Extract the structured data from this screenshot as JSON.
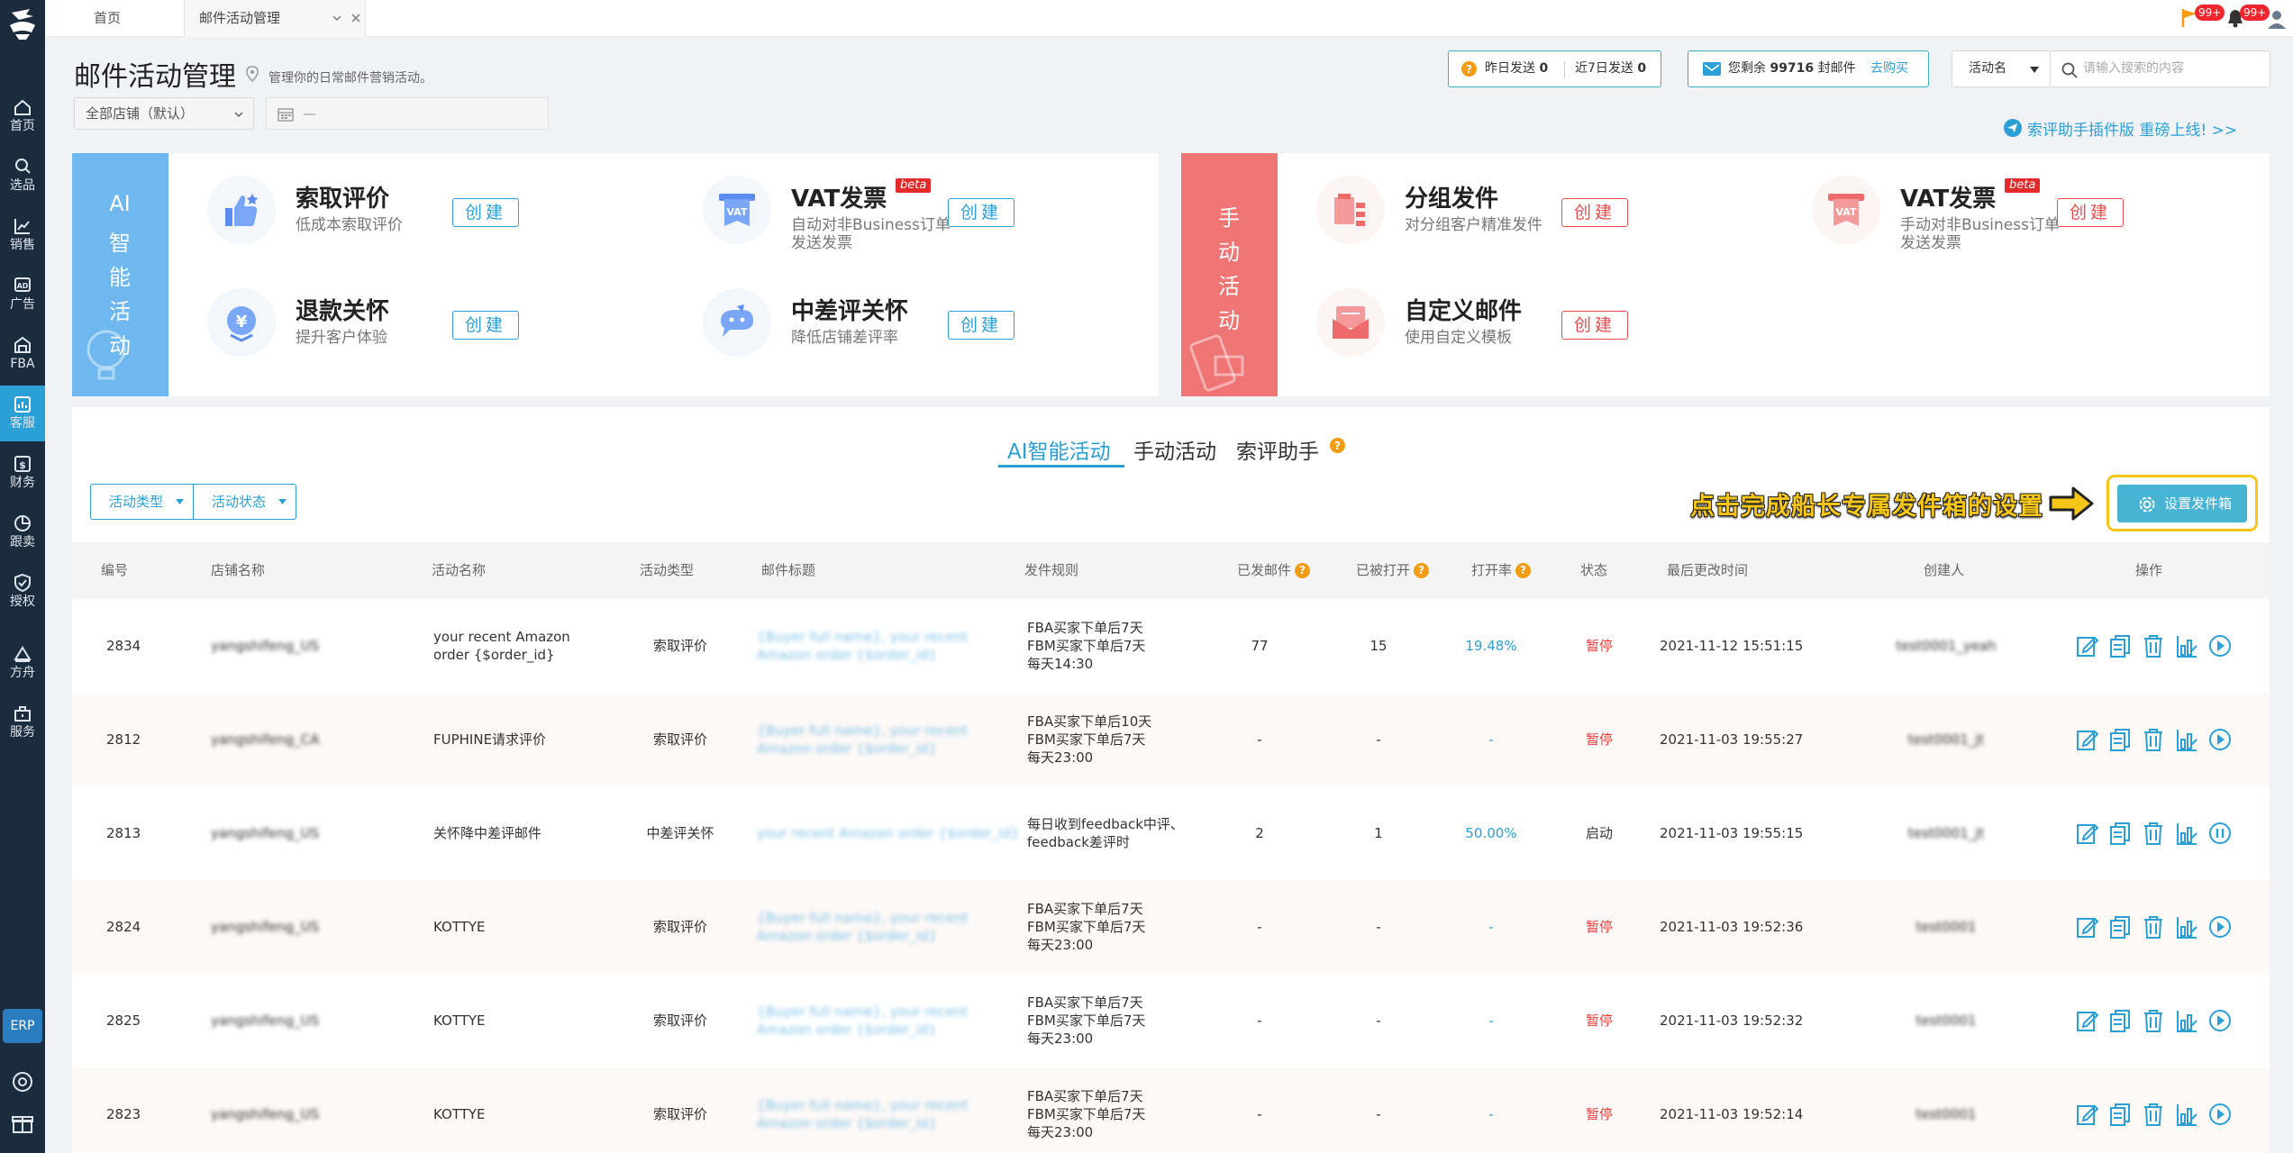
{
  "nav": [
    {
      "label": "首页",
      "icon": "home-icon"
    },
    {
      "label": "选品",
      "icon": "search-icon"
    },
    {
      "label": "销售",
      "icon": "chart-icon"
    },
    {
      "label": "广告",
      "icon": "ad-icon"
    },
    {
      "label": "FBA",
      "icon": "warehouse-icon"
    },
    {
      "label": "客服",
      "icon": "customer-service-icon"
    },
    {
      "label": "财务",
      "icon": "finance-icon"
    },
    {
      "label": "跟卖",
      "icon": "pie-icon"
    },
    {
      "label": "授权",
      "icon": "shield-icon"
    },
    {
      "label": "方舟",
      "icon": "ark-icon"
    },
    {
      "label": "服务",
      "icon": "service-icon"
    }
  ],
  "erp": "ERP",
  "tabs": {
    "home": "首页",
    "current": "邮件活动管理"
  },
  "badges": {
    "flag": "99+",
    "bell": "99+"
  },
  "page": {
    "title": "邮件活动管理",
    "subtitle": "管理你的日常邮件营销活动。"
  },
  "filters": {
    "store": "全部店铺（默认）",
    "date": "—"
  },
  "stats": {
    "yesterday_label": "昨日发送",
    "yesterday_value": "0",
    "week_label": "近7日发送",
    "week_value": "0"
  },
  "mail": {
    "remain_label": "您剩余",
    "remain_value": "99716",
    "unit": "封邮件",
    "buy": "去购买"
  },
  "search": {
    "select": "活动名",
    "placeholder": "请输入搜索的内容"
  },
  "promo": "索评助手插件版 重磅上线! >>",
  "ai_panel": {
    "ribbon": [
      "AI",
      "智",
      "能",
      "活",
      "动"
    ],
    "cards": [
      {
        "title": "索取评价",
        "desc": "低成本索取评价",
        "btn": "创建",
        "icon": "thumbs-up-icon"
      },
      {
        "title": "VAT发票",
        "desc": "自动对非Business订单发送发票",
        "btn": "创建",
        "badge": "beta",
        "icon": "vat-invoice-icon"
      },
      {
        "title": "退款关怀",
        "desc": "提升客户体验",
        "btn": "创建",
        "icon": "yuan-refund-icon"
      },
      {
        "title": "中差评关怀",
        "desc": "降低店铺差评率",
        "btn": "创建",
        "icon": "chat-care-icon"
      }
    ]
  },
  "manual_panel": {
    "ribbon": [
      "手",
      "动",
      "活",
      "动"
    ],
    "cards": [
      {
        "title": "分组发件",
        "desc": "对分组客户精准发件",
        "btn": "创建",
        "icon": "group-send-icon"
      },
      {
        "title": "VAT发票",
        "desc": "手动对非Business订单发送发票",
        "btn": "创建",
        "badge": "beta",
        "icon": "vat-invoice-icon"
      },
      {
        "title": "自定义邮件",
        "desc": "使用自定义模板",
        "btn": "创建",
        "icon": "custom-mail-icon"
      }
    ]
  },
  "main_tabs": [
    "AI智能活动",
    "手动活动",
    "索评助手"
  ],
  "filter_btns": [
    "活动类型",
    "活动状态"
  ],
  "callout": "点击完成船长专属发件箱的设置",
  "setup_btn": "设置发件箱",
  "columns": [
    "编号",
    "店铺名称",
    "活动名称",
    "活动类型",
    "邮件标题",
    "发件规则",
    "已发邮件",
    "已被打开",
    "打开率",
    "状态",
    "最后更改时间",
    "创建人",
    "操作"
  ],
  "rows": [
    {
      "id": "2834",
      "store": "yangshifeng_US",
      "name": [
        "your recent Amazon",
        "order {$order_id}"
      ],
      "type": "索取评价",
      "subject": [
        "{Buyer full name}, your recent",
        "Amazon order {$order_id}"
      ],
      "rules": [
        "FBA买家下单后7天",
        "FBM买家下单后7天",
        "每天14:30"
      ],
      "sent": "77",
      "opened": "15",
      "rate": "19.48%",
      "status": "暂停",
      "updated": "2021-11-12 15:51:15",
      "creator": "test0001_yeah",
      "last": "play"
    },
    {
      "id": "2812",
      "store": "yangshifeng_CA",
      "name": [
        "FUPHINE请求评价"
      ],
      "type": "索取评价",
      "subject": [
        "{Buyer full name}, your recent",
        "Amazon order {$order_id}"
      ],
      "rules": [
        "FBA买家下单后10天",
        "FBM买家下单后7天",
        "每天23:00"
      ],
      "sent": "-",
      "opened": "-",
      "rate": "-",
      "status": "暂停",
      "updated": "2021-11-03 19:55:27",
      "creator": "test0001_jt",
      "last": "play"
    },
    {
      "id": "2813",
      "store": "yangshifeng_US",
      "name": [
        "关怀降中差评邮件"
      ],
      "type": "中差评关怀",
      "subject": [
        "your recent Amazon order {$order_id}"
      ],
      "rules": [
        "每日收到feedback中评、",
        "feedback差评时"
      ],
      "sent": "2",
      "opened": "1",
      "rate": "50.00%",
      "status": "启动",
      "updated": "2021-11-03 19:55:15",
      "creator": "test0001_jt",
      "last": "pause"
    },
    {
      "id": "2824",
      "store": "yangshifeng_US",
      "name": [
        "KOTTYE"
      ],
      "type": "索取评价",
      "subject": [
        "{Buyer full name}, your recent",
        "Amazon order {$order_id}"
      ],
      "rules": [
        "FBA买家下单后7天",
        "FBM买家下单后7天",
        "每天23:00"
      ],
      "sent": "-",
      "opened": "-",
      "rate": "-",
      "status": "暂停",
      "updated": "2021-11-03 19:52:36",
      "creator": "test0001",
      "last": "play"
    },
    {
      "id": "2825",
      "store": "yangshifeng_US",
      "name": [
        "KOTTYE"
      ],
      "type": "索取评价",
      "subject": [
        "{Buyer full name}, your recent",
        "Amazon order {$order_id}"
      ],
      "rules": [
        "FBA买家下单后7天",
        "FBM买家下单后7天",
        "每天23:00"
      ],
      "sent": "-",
      "opened": "-",
      "rate": "-",
      "status": "暂停",
      "updated": "2021-11-03 19:52:32",
      "creator": "test0001",
      "last": "play"
    },
    {
      "id": "2823",
      "store": "yangshifeng_US",
      "name": [
        "KOTTYE"
      ],
      "type": "索取评价",
      "subject": [
        "{Buyer full name}, your recent",
        "Amazon order {$order_id}"
      ],
      "rules": [
        "FBA买家下单后7天",
        "FBM买家下单后7天",
        "每天23:00"
      ],
      "sent": "-",
      "opened": "-",
      "rate": "-",
      "status": "暂停",
      "updated": "2021-11-03 19:52:14",
      "creator": "test0001",
      "last": "play"
    }
  ]
}
